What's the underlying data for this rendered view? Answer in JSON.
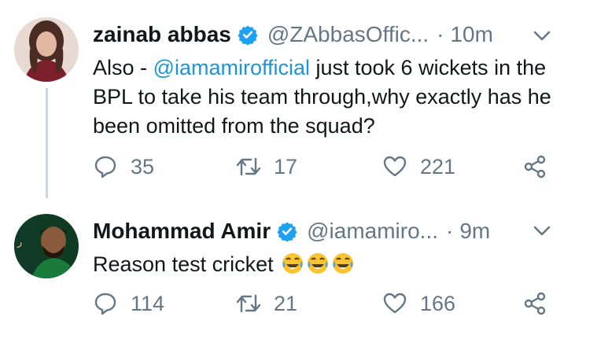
{
  "tweets": [
    {
      "name": "zainab abbas",
      "handle": "@ZAbbasOffic...",
      "separator": "·",
      "time": "10m",
      "text_before": "Also - ",
      "mention": "@iamamirofficial",
      "text_after": " just took 6 wickets in the BPL to take his team through,why exactly has he been omitted from the squad?",
      "replies": "35",
      "retweets": "17",
      "likes": "221",
      "verified": true
    },
    {
      "name": "Mohammad Amir",
      "handle": "@iamamiro...",
      "separator": "·",
      "time": "9m",
      "text": "Reason test cricket",
      "emojis": [
        "face-with-tears-of-joy",
        "face-with-tears-of-joy",
        "face-with-tears-of-joy"
      ],
      "replies": "114",
      "retweets": "21",
      "likes": "166",
      "verified": true
    }
  ],
  "colors": {
    "text": "#14171a",
    "secondary": "#657786",
    "mention": "#1b95e0",
    "verified_badge": "#1da1f2",
    "thread_line": "#ccd6dd"
  }
}
